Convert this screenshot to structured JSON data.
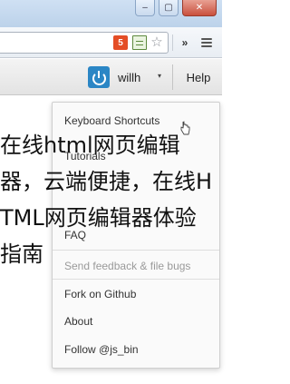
{
  "window": {
    "minimize_glyph": "–",
    "maximize_glyph": "▢",
    "close_glyph": "✕"
  },
  "toolbar": {
    "html5_badge": "5",
    "icons": [
      "html5-icon",
      "page-icon",
      "star-icon",
      "more-icon",
      "menu-icon"
    ],
    "more_glyph": "»",
    "star_glyph": "☆"
  },
  "appbar": {
    "username": "willh",
    "user_caret": "▾",
    "help_label": "Help"
  },
  "help_menu": {
    "items": [
      {
        "label": "Keyboard Shortcuts",
        "disabled": false
      },
      {
        "label": "Tutorials",
        "disabled": false
      },
      {
        "label": "FAQ",
        "disabled": false
      },
      {
        "label": "Send feedback & file bugs",
        "disabled": true
      },
      {
        "label": "Fork on Github",
        "disabled": false
      },
      {
        "label": "About",
        "disabled": false
      },
      {
        "label": "Follow @js_bin",
        "disabled": false
      }
    ]
  },
  "overlay_text": "在线html网页编辑\n器，云端便捷，在线H\nTML网页编辑器体验\n指南",
  "colors": {
    "power_button": "#2b86c5",
    "html5_badge": "#e44d26",
    "close_button": "#c9503d"
  }
}
